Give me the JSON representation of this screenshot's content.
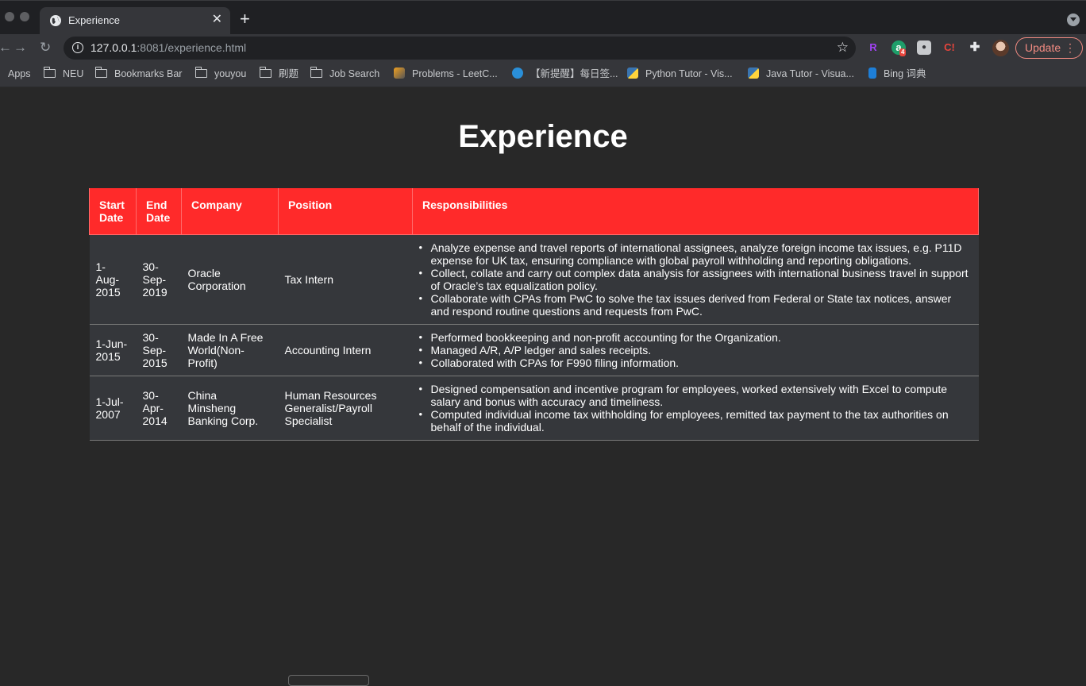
{
  "browser": {
    "tab_title": "Experience",
    "url_host": "127.0.0.1",
    "url_rest": ":8081/experience.html",
    "update_label": "Update",
    "extension_badge": "4",
    "bookmarks": [
      {
        "label": "Apps",
        "icon": "apps-icon"
      },
      {
        "label": "NEU",
        "icon": "folder-icon"
      },
      {
        "label": "Bookmarks Bar",
        "icon": "folder-icon"
      },
      {
        "label": "youyou",
        "icon": "folder-icon"
      },
      {
        "label": "刷题",
        "icon": "folder-icon"
      },
      {
        "label": "Job Search",
        "icon": "folder-icon"
      },
      {
        "label": "Problems - LeetC...",
        "icon": "leetcode-icon"
      },
      {
        "label": "【新提醒】每日签...",
        "icon": "site-icon"
      },
      {
        "label": "Python Tutor - Vis...",
        "icon": "python-icon"
      },
      {
        "label": "Java Tutor - Visua...",
        "icon": "python-icon"
      },
      {
        "label": "Bing 词典",
        "icon": "bing-icon"
      }
    ]
  },
  "page": {
    "title": "Experience",
    "headers": {
      "start_line1": "Start",
      "start_line2": "Date",
      "end_line1": "End",
      "end_line2": "Date",
      "company": "Company",
      "position": "Position",
      "responsibilities": "Responsibilities"
    },
    "rows": [
      {
        "start": [
          "1-",
          "Aug-",
          "2015"
        ],
        "end": [
          "30-",
          "Sep-",
          "2019"
        ],
        "company": [
          "Oracle",
          "Corporation"
        ],
        "position": [
          "Tax Intern"
        ],
        "responsibilities": [
          "Analyze expense and travel reports of international assignees, analyze foreign income tax issues, e.g. P11D expense for UK tax, ensuring compliance with global payroll withholding and reporting obligations.",
          "Collect, collate and carry out complex data analysis for assignees with international business travel in support of Oracle’s tax equalization policy.",
          "Collaborate with CPAs from PwC to solve the tax issues derived from Federal or State tax notices, answer and respond routine questions and requests from PwC."
        ]
      },
      {
        "start": [
          "1-Jun-",
          "2015"
        ],
        "end": [
          "30-",
          "Sep-",
          "2015"
        ],
        "company": [
          "Made In A Free",
          "World(Non-",
          "Profit)"
        ],
        "position": [
          "Accounting Intern"
        ],
        "responsibilities": [
          "Performed bookkeeping and non-profit accounting for the Organization.",
          "Managed A/R, A/P ledger and sales receipts.",
          "Collaborated with CPAs for F990 filing information."
        ]
      },
      {
        "start": [
          "1-Jul-",
          "2007"
        ],
        "end": [
          "30-",
          "Apr-",
          "2014"
        ],
        "company": [
          "China",
          "Minsheng",
          "Banking Corp."
        ],
        "position": [
          "Human Resources",
          "Generalist/Payroll",
          "Specialist"
        ],
        "responsibilities": [
          "Designed compensation and incentive program for employees, worked extensively with Excel to compute salary and bonus with accuracy and timeliness.",
          "Computed individual income tax withholding for employees, remitted tax payment to the tax authorities on behalf of the individual."
        ]
      }
    ]
  }
}
